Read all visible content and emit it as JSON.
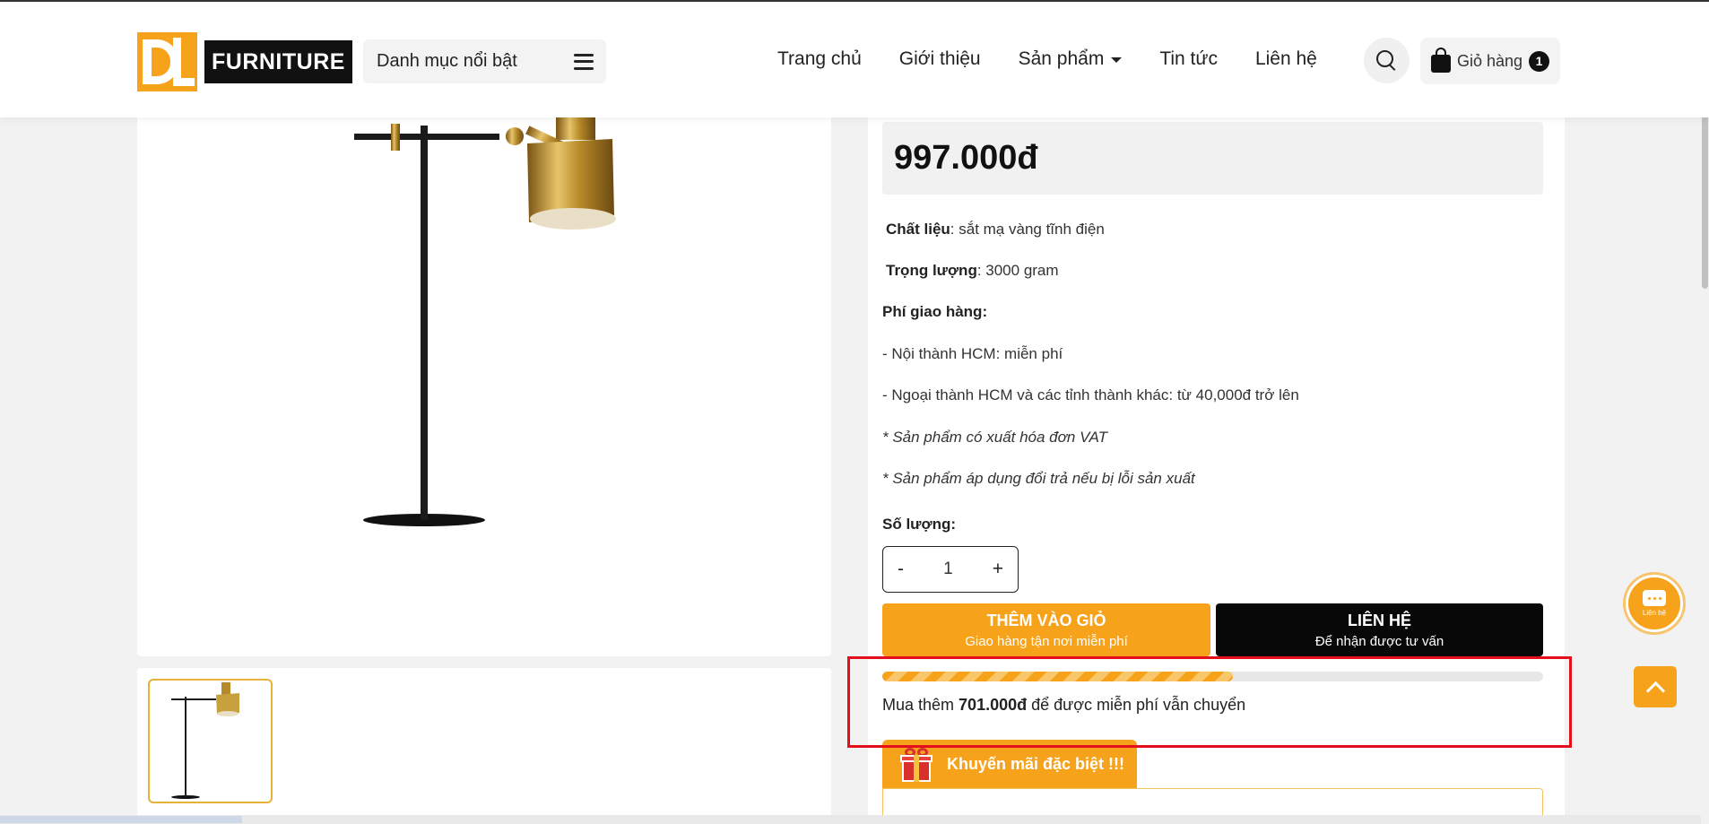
{
  "brand": {
    "logo_text": "FURNITURE",
    "accent_color": "#f7a21b"
  },
  "header": {
    "category_menu_label": "Danh mục nổi bật",
    "nav": [
      "Trang chủ",
      "Giới thiệu",
      "Sản phẩm",
      "Tin tức",
      "Liên hệ"
    ],
    "cart_label": "Giỏ hàng",
    "cart_count": "1",
    "icons": [
      "menu-icon",
      "search-icon",
      "shopping-bag-icon",
      "chevron-down-icon"
    ]
  },
  "product": {
    "price": "997.000đ",
    "specs": {
      "material_label": "Chất liệu",
      "material_value": ": sắt mạ vàng tĩnh điện",
      "weight_label": "Trọng lượng",
      "weight_value": ": 3000 gram"
    },
    "shipping_heading": "Phí giao hàng:",
    "shipping_lines": [
      "- Nội thành HCM: miễn phí",
      "- Ngoại thành HCM và các tỉnh thành khác: từ 40,000đ trở lên"
    ],
    "notes": [
      "* Sản phẩm có xuất hóa đơn VAT",
      "* Sản phẩm áp dụng đổi trả nếu bị lỗi sản xuất"
    ],
    "quantity_label": "Số lượng:",
    "quantity": "1",
    "minus": "-",
    "plus": "+"
  },
  "actions": {
    "add_to_cart_label": "THÊM VÀO GIỎ",
    "add_to_cart_sub": "Giao hàng tận nơi miễn phí",
    "contact_label": "LIÊN HỆ",
    "contact_sub": "Để nhận được tư vấn"
  },
  "free_shipping": {
    "progress_fraction": 0.53,
    "prefix": "Mua thêm ",
    "amount": "701.000đ",
    "suffix": " để được miễn phí vẫn chuyển"
  },
  "promotion": {
    "title": "Khuyến mãi đặc biệt !!!",
    "icon": "gift-icon"
  },
  "floating": {
    "chat_label": "Liên hệ",
    "chat_icon": "chat-icon",
    "top_icon": "chevron-up-icon"
  }
}
